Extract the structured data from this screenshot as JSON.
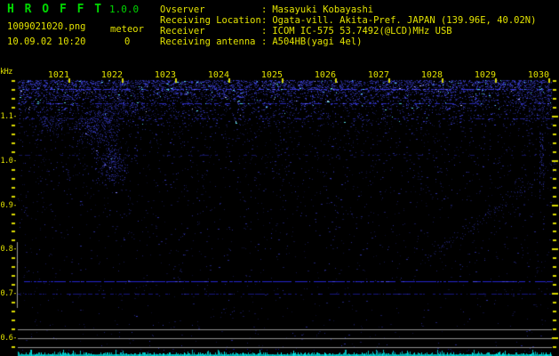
{
  "app": {
    "name": "HROFFT",
    "title_display": "H R O F F T",
    "version": "1.0.0"
  },
  "colors": {
    "accent_green": "#00d800",
    "accent_yellow": "#e2e200",
    "noise_blue": "#2020c0",
    "carrier_blue": "#2525cc",
    "reference_gray": "#8f8f8f",
    "trace_cyan": "#00c8c8",
    "background": "#000000"
  },
  "header": {
    "filename": "1009021020.png",
    "mode_label": "meteor",
    "meteor_count": "0",
    "datetime": "10.09.02 10:20",
    "info_colon": ":",
    "info_rows": [
      {
        "label": "Ovserver",
        "value": "Masayuki Kobayashi"
      },
      {
        "label": "Receiving Location",
        "value": "Ogata-vill. Akita-Pref. JAPAN (139.96E, 40.02N)"
      },
      {
        "label": "Receiver",
        "value": "ICOM IC-575 53.7492(@LCD)MHz USB"
      },
      {
        "label": "Receiving antenna",
        "value": "A504HB(yagi 4el)"
      }
    ]
  },
  "chart_data": {
    "type": "heatmap",
    "subtype": "radio-meteor-spectrogram",
    "title": "",
    "x_axis": {
      "unit": "HHMM",
      "tick_labels": [
        "1021",
        "1022",
        "1023",
        "1024",
        "1025",
        "1026",
        "1027",
        "1028",
        "1029",
        "1030"
      ],
      "minutes_per_division": 1
    },
    "y_axis": {
      "unit": "kHz",
      "tick_labels": [
        "1.1",
        "1.0",
        "0.9",
        "0.8",
        "0.7",
        "0.6"
      ],
      "major_tick_glyph": "-",
      "range_khz": [
        0.56,
        1.18
      ],
      "minor_ticks_per_major": 5
    },
    "carrier_lines_khz": [
      0.73,
      0.7
    ],
    "reference_lines_khz": [
      0.62,
      0.6,
      0.58
    ],
    "meteor_echo_count": 0,
    "features": [
      "dense broadband blue noise band across top of spectrogram above ~1.1 kHz",
      "speckled horizontal interference lines near 1.16, 1.13 and 1.10 kHz",
      "noise plume descending from ~1.15 kHz to ~0.85 kHz during 1021-1022",
      "faint trace rising toward right edge near 1029-1030 between 0.8 and 1.0 kHz",
      "dotted carrier lines spanning full width near 0.73 and 0.70 kHz",
      "three solid gray reference lines near 0.62, 0.60 and 0.58 kHz",
      "short vertical gray calibration bar at left edge between ~0.82 and ~0.67 kHz",
      "jagged cyan signal-strength trace along bottom edge"
    ]
  }
}
